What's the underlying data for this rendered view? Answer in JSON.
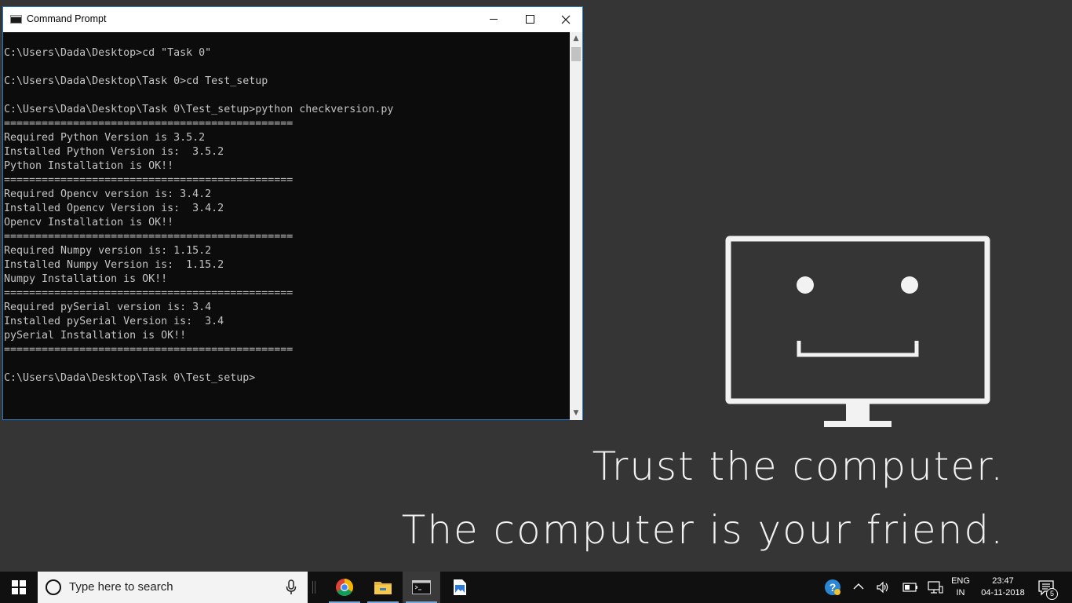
{
  "window": {
    "title": "Command Prompt",
    "controls": {
      "minimize": "minimize",
      "maximize": "maximize",
      "close": "close"
    }
  },
  "console": {
    "lines": [
      "C:\\Users\\Dada\\Desktop>cd \"Task 0\"",
      "",
      "C:\\Users\\Dada\\Desktop\\Task 0>cd Test_setup",
      "",
      "C:\\Users\\Dada\\Desktop\\Task 0\\Test_setup>python checkversion.py",
      "==============================================",
      "Required Python Version is 3.5.2",
      "Installed Python Version is:  3.5.2",
      "Python Installation is OK!!",
      "==============================================",
      "Required Opencv version is: 3.4.2",
      "Installed Opencv Version is:  3.4.2",
      "Opencv Installation is OK!!",
      "==============================================",
      "Required Numpy version is: 1.15.2",
      "Installed Numpy Version is:  1.15.2",
      "Numpy Installation is OK!!",
      "==============================================",
      "Required pySerial version is: 3.4",
      "Installed pySerial Version is:  3.4",
      "pySerial Installation is OK!!",
      "==============================================",
      "",
      "C:\\Users\\Dada\\Desktop\\Task 0\\Test_setup>"
    ],
    "text_color": "#c4c4c4",
    "background": "#0c0c0c"
  },
  "wallpaper": {
    "line1": "Trust the computer.",
    "line2": "The computer is your friend.",
    "background": "#353535",
    "foreground": "#f2f2f2"
  },
  "taskbar": {
    "search_placeholder": "Type here to search",
    "apps": [
      {
        "name": "Google Chrome",
        "icon": "chrome-icon"
      },
      {
        "name": "File Explorer",
        "icon": "folder-icon"
      },
      {
        "name": "Command Prompt",
        "icon": "cmd-icon",
        "active": true
      },
      {
        "name": "Photos",
        "icon": "image-icon"
      }
    ],
    "tray": {
      "lang_top": "ENG",
      "lang_bottom": "IN",
      "time": "23:47",
      "date": "04-11-2018",
      "notifications": "5"
    }
  }
}
